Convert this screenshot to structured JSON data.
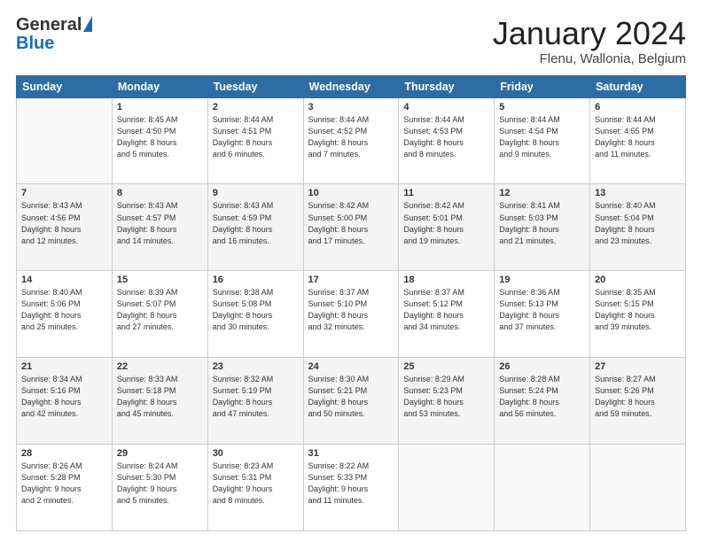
{
  "header": {
    "logo_general": "General",
    "logo_blue": "Blue",
    "title": "January 2024",
    "location": "Flenu, Wallonia, Belgium"
  },
  "days_of_week": [
    "Sunday",
    "Monday",
    "Tuesday",
    "Wednesday",
    "Thursday",
    "Friday",
    "Saturday"
  ],
  "weeks": [
    [
      {
        "day": "",
        "detail": ""
      },
      {
        "day": "1",
        "detail": "Sunrise: 8:45 AM\nSunset: 4:50 PM\nDaylight: 8 hours\nand 5 minutes."
      },
      {
        "day": "2",
        "detail": "Sunrise: 8:44 AM\nSunset: 4:51 PM\nDaylight: 8 hours\nand 6 minutes."
      },
      {
        "day": "3",
        "detail": "Sunrise: 8:44 AM\nSunset: 4:52 PM\nDaylight: 8 hours\nand 7 minutes."
      },
      {
        "day": "4",
        "detail": "Sunrise: 8:44 AM\nSunset: 4:53 PM\nDaylight: 8 hours\nand 8 minutes."
      },
      {
        "day": "5",
        "detail": "Sunrise: 8:44 AM\nSunset: 4:54 PM\nDaylight: 8 hours\nand 9 minutes."
      },
      {
        "day": "6",
        "detail": "Sunrise: 8:44 AM\nSunset: 4:55 PM\nDaylight: 8 hours\nand 11 minutes."
      }
    ],
    [
      {
        "day": "7",
        "detail": "Sunrise: 8:43 AM\nSunset: 4:56 PM\nDaylight: 8 hours\nand 12 minutes."
      },
      {
        "day": "8",
        "detail": "Sunrise: 8:43 AM\nSunset: 4:57 PM\nDaylight: 8 hours\nand 14 minutes."
      },
      {
        "day": "9",
        "detail": "Sunrise: 8:43 AM\nSunset: 4:59 PM\nDaylight: 8 hours\nand 16 minutes."
      },
      {
        "day": "10",
        "detail": "Sunrise: 8:42 AM\nSunset: 5:00 PM\nDaylight: 8 hours\nand 17 minutes."
      },
      {
        "day": "11",
        "detail": "Sunrise: 8:42 AM\nSunset: 5:01 PM\nDaylight: 8 hours\nand 19 minutes."
      },
      {
        "day": "12",
        "detail": "Sunrise: 8:41 AM\nSunset: 5:03 PM\nDaylight: 8 hours\nand 21 minutes."
      },
      {
        "day": "13",
        "detail": "Sunrise: 8:40 AM\nSunset: 5:04 PM\nDaylight: 8 hours\nand 23 minutes."
      }
    ],
    [
      {
        "day": "14",
        "detail": "Sunrise: 8:40 AM\nSunset: 5:06 PM\nDaylight: 8 hours\nand 25 minutes."
      },
      {
        "day": "15",
        "detail": "Sunrise: 8:39 AM\nSunset: 5:07 PM\nDaylight: 8 hours\nand 27 minutes."
      },
      {
        "day": "16",
        "detail": "Sunrise: 8:38 AM\nSunset: 5:08 PM\nDaylight: 8 hours\nand 30 minutes."
      },
      {
        "day": "17",
        "detail": "Sunrise: 8:37 AM\nSunset: 5:10 PM\nDaylight: 8 hours\nand 32 minutes."
      },
      {
        "day": "18",
        "detail": "Sunrise: 8:37 AM\nSunset: 5:12 PM\nDaylight: 8 hours\nand 34 minutes."
      },
      {
        "day": "19",
        "detail": "Sunrise: 8:36 AM\nSunset: 5:13 PM\nDaylight: 8 hours\nand 37 minutes."
      },
      {
        "day": "20",
        "detail": "Sunrise: 8:35 AM\nSunset: 5:15 PM\nDaylight: 8 hours\nand 39 minutes."
      }
    ],
    [
      {
        "day": "21",
        "detail": "Sunrise: 8:34 AM\nSunset: 5:16 PM\nDaylight: 8 hours\nand 42 minutes."
      },
      {
        "day": "22",
        "detail": "Sunrise: 8:33 AM\nSunset: 5:18 PM\nDaylight: 8 hours\nand 45 minutes."
      },
      {
        "day": "23",
        "detail": "Sunrise: 8:32 AM\nSunset: 5:19 PM\nDaylight: 8 hours\nand 47 minutes."
      },
      {
        "day": "24",
        "detail": "Sunrise: 8:30 AM\nSunset: 5:21 PM\nDaylight: 8 hours\nand 50 minutes."
      },
      {
        "day": "25",
        "detail": "Sunrise: 8:29 AM\nSunset: 5:23 PM\nDaylight: 8 hours\nand 53 minutes."
      },
      {
        "day": "26",
        "detail": "Sunrise: 8:28 AM\nSunset: 5:24 PM\nDaylight: 8 hours\nand 56 minutes."
      },
      {
        "day": "27",
        "detail": "Sunrise: 8:27 AM\nSunset: 5:26 PM\nDaylight: 8 hours\nand 59 minutes."
      }
    ],
    [
      {
        "day": "28",
        "detail": "Sunrise: 8:26 AM\nSunset: 5:28 PM\nDaylight: 9 hours\nand 2 minutes."
      },
      {
        "day": "29",
        "detail": "Sunrise: 8:24 AM\nSunset: 5:30 PM\nDaylight: 9 hours\nand 5 minutes."
      },
      {
        "day": "30",
        "detail": "Sunrise: 8:23 AM\nSunset: 5:31 PM\nDaylight: 9 hours\nand 8 minutes."
      },
      {
        "day": "31",
        "detail": "Sunrise: 8:22 AM\nSunset: 5:33 PM\nDaylight: 9 hours\nand 11 minutes."
      },
      {
        "day": "",
        "detail": ""
      },
      {
        "day": "",
        "detail": ""
      },
      {
        "day": "",
        "detail": ""
      }
    ]
  ]
}
